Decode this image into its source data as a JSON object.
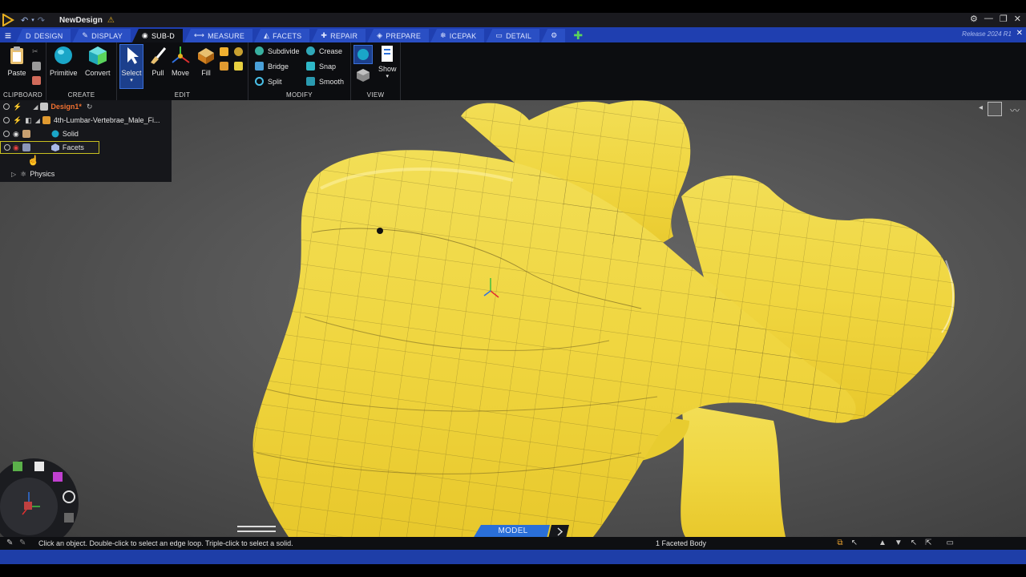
{
  "window": {
    "doc_title": "NewDesign",
    "release": "Release 2024 R1"
  },
  "tabs": [
    {
      "label": "Design",
      "icon": "D"
    },
    {
      "label": "Display",
      "icon": "✎"
    },
    {
      "label": "Sub-D",
      "icon": "◉"
    },
    {
      "label": "Measure",
      "icon": "⟷"
    },
    {
      "label": "Facets",
      "icon": "◭"
    },
    {
      "label": "Repair",
      "icon": "✚"
    },
    {
      "label": "Prepare",
      "icon": "◈"
    },
    {
      "label": "Icepak",
      "icon": "❄"
    },
    {
      "label": "Detail",
      "icon": "▭"
    }
  ],
  "ribbon": {
    "clipboard": {
      "label": "Clipboard",
      "paste": "Paste"
    },
    "create": {
      "label": "Create",
      "primitive": "Primitive",
      "convert": "Convert"
    },
    "edit": {
      "label": "Edit",
      "select": "Select",
      "pull": "Pull",
      "move": "Move",
      "fill": "Fill"
    },
    "modify": {
      "label": "Modify",
      "subdivide": "Subdivide",
      "crease": "Crease",
      "bridge": "Bridge",
      "snap": "Snap",
      "split": "Split",
      "smooth": "Smooth"
    },
    "view": {
      "label": "View",
      "show": "Show"
    }
  },
  "tree": {
    "design": "Design1*",
    "part": "4th-Lumbar-Vertebrae_Male_Fi...",
    "solid": "Solid",
    "facets": "Facets",
    "physics": "Physics"
  },
  "viewport": {
    "model_tab": "Model"
  },
  "status": {
    "hint": "Click an object. Double-click to select an edge loop. Triple-click to select a solid.",
    "selection": "1 Faceted Body"
  }
}
